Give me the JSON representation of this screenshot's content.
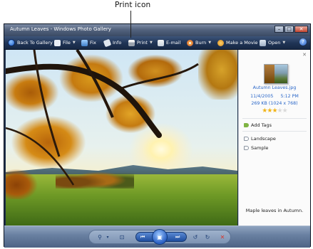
{
  "callout": {
    "label": "Print icon"
  },
  "window": {
    "title": "Autumn Leaves - Windows Photo Gallery"
  },
  "window_buttons": {
    "minimize": "–",
    "maximize": "□",
    "close": "✕"
  },
  "toolbar": {
    "back_label": "Back To Gallery",
    "file_label": "File",
    "fix_label": "Fix",
    "info_label": "Info",
    "print_label": "Print",
    "email_label": "E-mail",
    "burn_label": "Burn",
    "movie_label": "Make a Movie",
    "open_label": "Open",
    "help_label": "?"
  },
  "details": {
    "close": "✕",
    "filename": "Autumn Leaves.jpg",
    "date": "11/4/2005",
    "time": "5:12 PM",
    "size": "269 KB (1024 x 768)",
    "rating": 3,
    "rating_max": 5,
    "add_tags_label": "Add Tags",
    "tags": [
      "Landscape",
      "Sample"
    ],
    "caption": "Maple leaves in Autumn."
  },
  "controls": {
    "search_icon": "⚲",
    "search_arrow": "▾",
    "fit_icon": "⊡",
    "prev_icon": "⏮",
    "play_icon": "▣",
    "next_icon": "⏭",
    "rotate_ccw_icon": "↺",
    "rotate_cw_icon": "↻",
    "delete_icon": "✕"
  },
  "colors": {
    "accent": "#2966c8",
    "star_on": "#f1b51b",
    "star_off": "#d9d9d9",
    "delete": "#d9352a"
  }
}
